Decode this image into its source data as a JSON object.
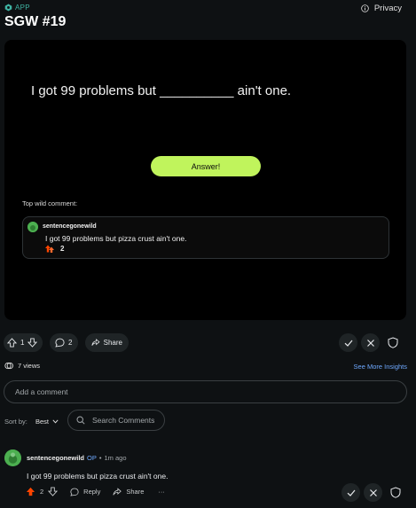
{
  "header": {
    "app_label": "APP",
    "privacy_label": "Privacy",
    "title": "SGW #19"
  },
  "game": {
    "prompt": "I got 99 problems but __________ ain't one.",
    "answer_button": "Answer!",
    "top_wild_label": "Top wild comment:",
    "top_comment": {
      "username": "sentencegonewild",
      "text": "I got 99 problems but pizza crust ain't one.",
      "votes": "2"
    }
  },
  "actions": {
    "vote_count": "1",
    "comment_count": "2",
    "share_label": "Share"
  },
  "stats": {
    "views": "7 views",
    "insights_link": "See More Insights"
  },
  "comment_box": {
    "placeholder": "Add a comment"
  },
  "sort": {
    "label": "Sort by:",
    "value": "Best",
    "search_placeholder": "Search Comments"
  },
  "comment": {
    "username": "sentencegonewild",
    "op_badge": "OP",
    "separator": "•",
    "time": "1m ago",
    "text": "I got 99 problems but pizza crust ain't one.",
    "votes": "2",
    "reply_label": "Reply",
    "share_label": "Share",
    "more_label": "···"
  },
  "colors": {
    "background": "#0e1113",
    "panel": "#000000",
    "accent_button": "#c0f45c",
    "link_blue": "#6ea8fe",
    "upvote_orange": "#ff4500",
    "app_teal": "#3fb4a3",
    "avatar_green": "#4caf50"
  }
}
